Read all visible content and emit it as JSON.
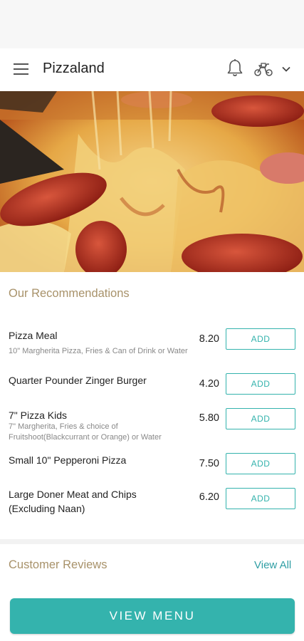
{
  "app": {
    "title": "Pizzaland"
  },
  "header": {
    "icons": [
      "menu-icon",
      "bell-icon",
      "delivery-scooter-icon",
      "chevron-down-icon"
    ]
  },
  "hero": {
    "image": "pepperoni-pizza-photo"
  },
  "recommendations": {
    "title": "Our Recommendations",
    "items": [
      {
        "name": "Pizza Meal",
        "description": "10\" Margherita Pizza, Fries & Can of Drink or Water",
        "price": "8.20",
        "button": "ADD"
      },
      {
        "name": "Quarter Pounder Zinger Burger",
        "description": "",
        "price": "4.20",
        "button": "ADD"
      },
      {
        "name": "7\" Pizza Kids",
        "description": "7\" Margherita, Fries & choice of Fruitshoot(Blackcurrant or Orange) or Water",
        "price": "5.80",
        "button": "ADD"
      },
      {
        "name": "Small 10\" Pepperoni Pizza",
        "description": "",
        "price": "7.50",
        "button": "ADD"
      },
      {
        "name": "Large Doner Meat and Chips (Excluding Naan)",
        "description": "",
        "price": "6.20",
        "button": "ADD"
      }
    ]
  },
  "reviews": {
    "title": "Customer Reviews",
    "view_all": "View All"
  },
  "footer": {
    "view_menu": "VIEW MENU"
  },
  "colors": {
    "accent": "#34b3ad",
    "section_title": "#a8926a",
    "link": "#2f9ea4"
  }
}
